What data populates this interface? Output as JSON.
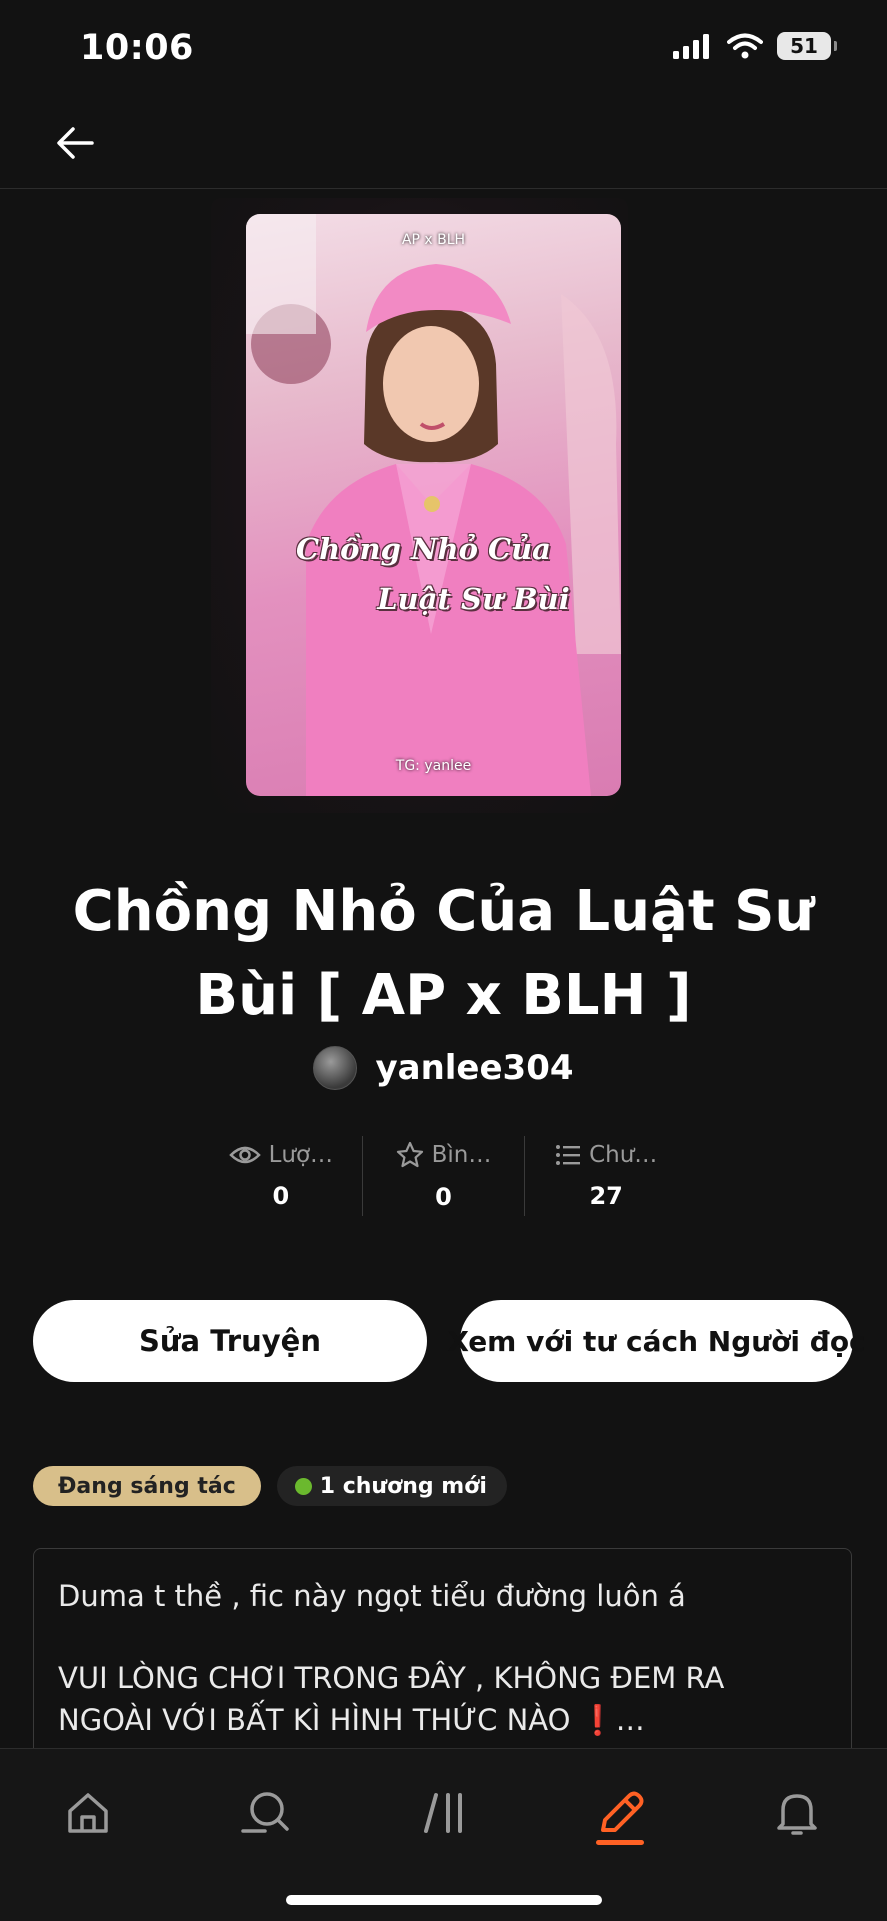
{
  "status_bar": {
    "time": "10:06",
    "battery": "51"
  },
  "story": {
    "cover": {
      "top_text": "AP x BLH",
      "title_line1": "Chồng Nhỏ Của",
      "title_line2": "Luật Sư Bùi",
      "author_text": "TG: yanlee"
    },
    "title": "Chồng Nhỏ Của Luật Sư Bùi [ AP x BLH ]",
    "author": "yanlee304"
  },
  "stats": [
    {
      "label": "Lượ…",
      "value": "0",
      "icon": "eye-icon"
    },
    {
      "label": "Bìn…",
      "value": "0",
      "icon": "star-icon"
    },
    {
      "label": "Chư…",
      "value": "27",
      "icon": "list-icon"
    }
  ],
  "buttons": {
    "edit": "Sửa Truyện",
    "view_as_reader": "Xem với tư cách Người đọc"
  },
  "tags": {
    "status": "Đang sáng tác",
    "new_chapter": "1 chương mới"
  },
  "description": {
    "line1": "Duma t thề , fic này ngọt tiểu đường luôn á",
    "line2": "VUI LÒNG CHƠI TRONG ĐÂY , KHÔNG ĐEM RA NGOÀI VỚI BẤT KÌ HÌNH THỨC NÀO ❗…"
  },
  "tab_bar": {
    "items": [
      "home-icon",
      "search-icon",
      "library-icon",
      "write-icon",
      "notifications-icon"
    ],
    "active": "write-icon",
    "active_color": "#ff6124"
  },
  "colors": {
    "status_tag": "#d8bf8a",
    "new_dot": "#6bb92e",
    "background": "#121212"
  }
}
